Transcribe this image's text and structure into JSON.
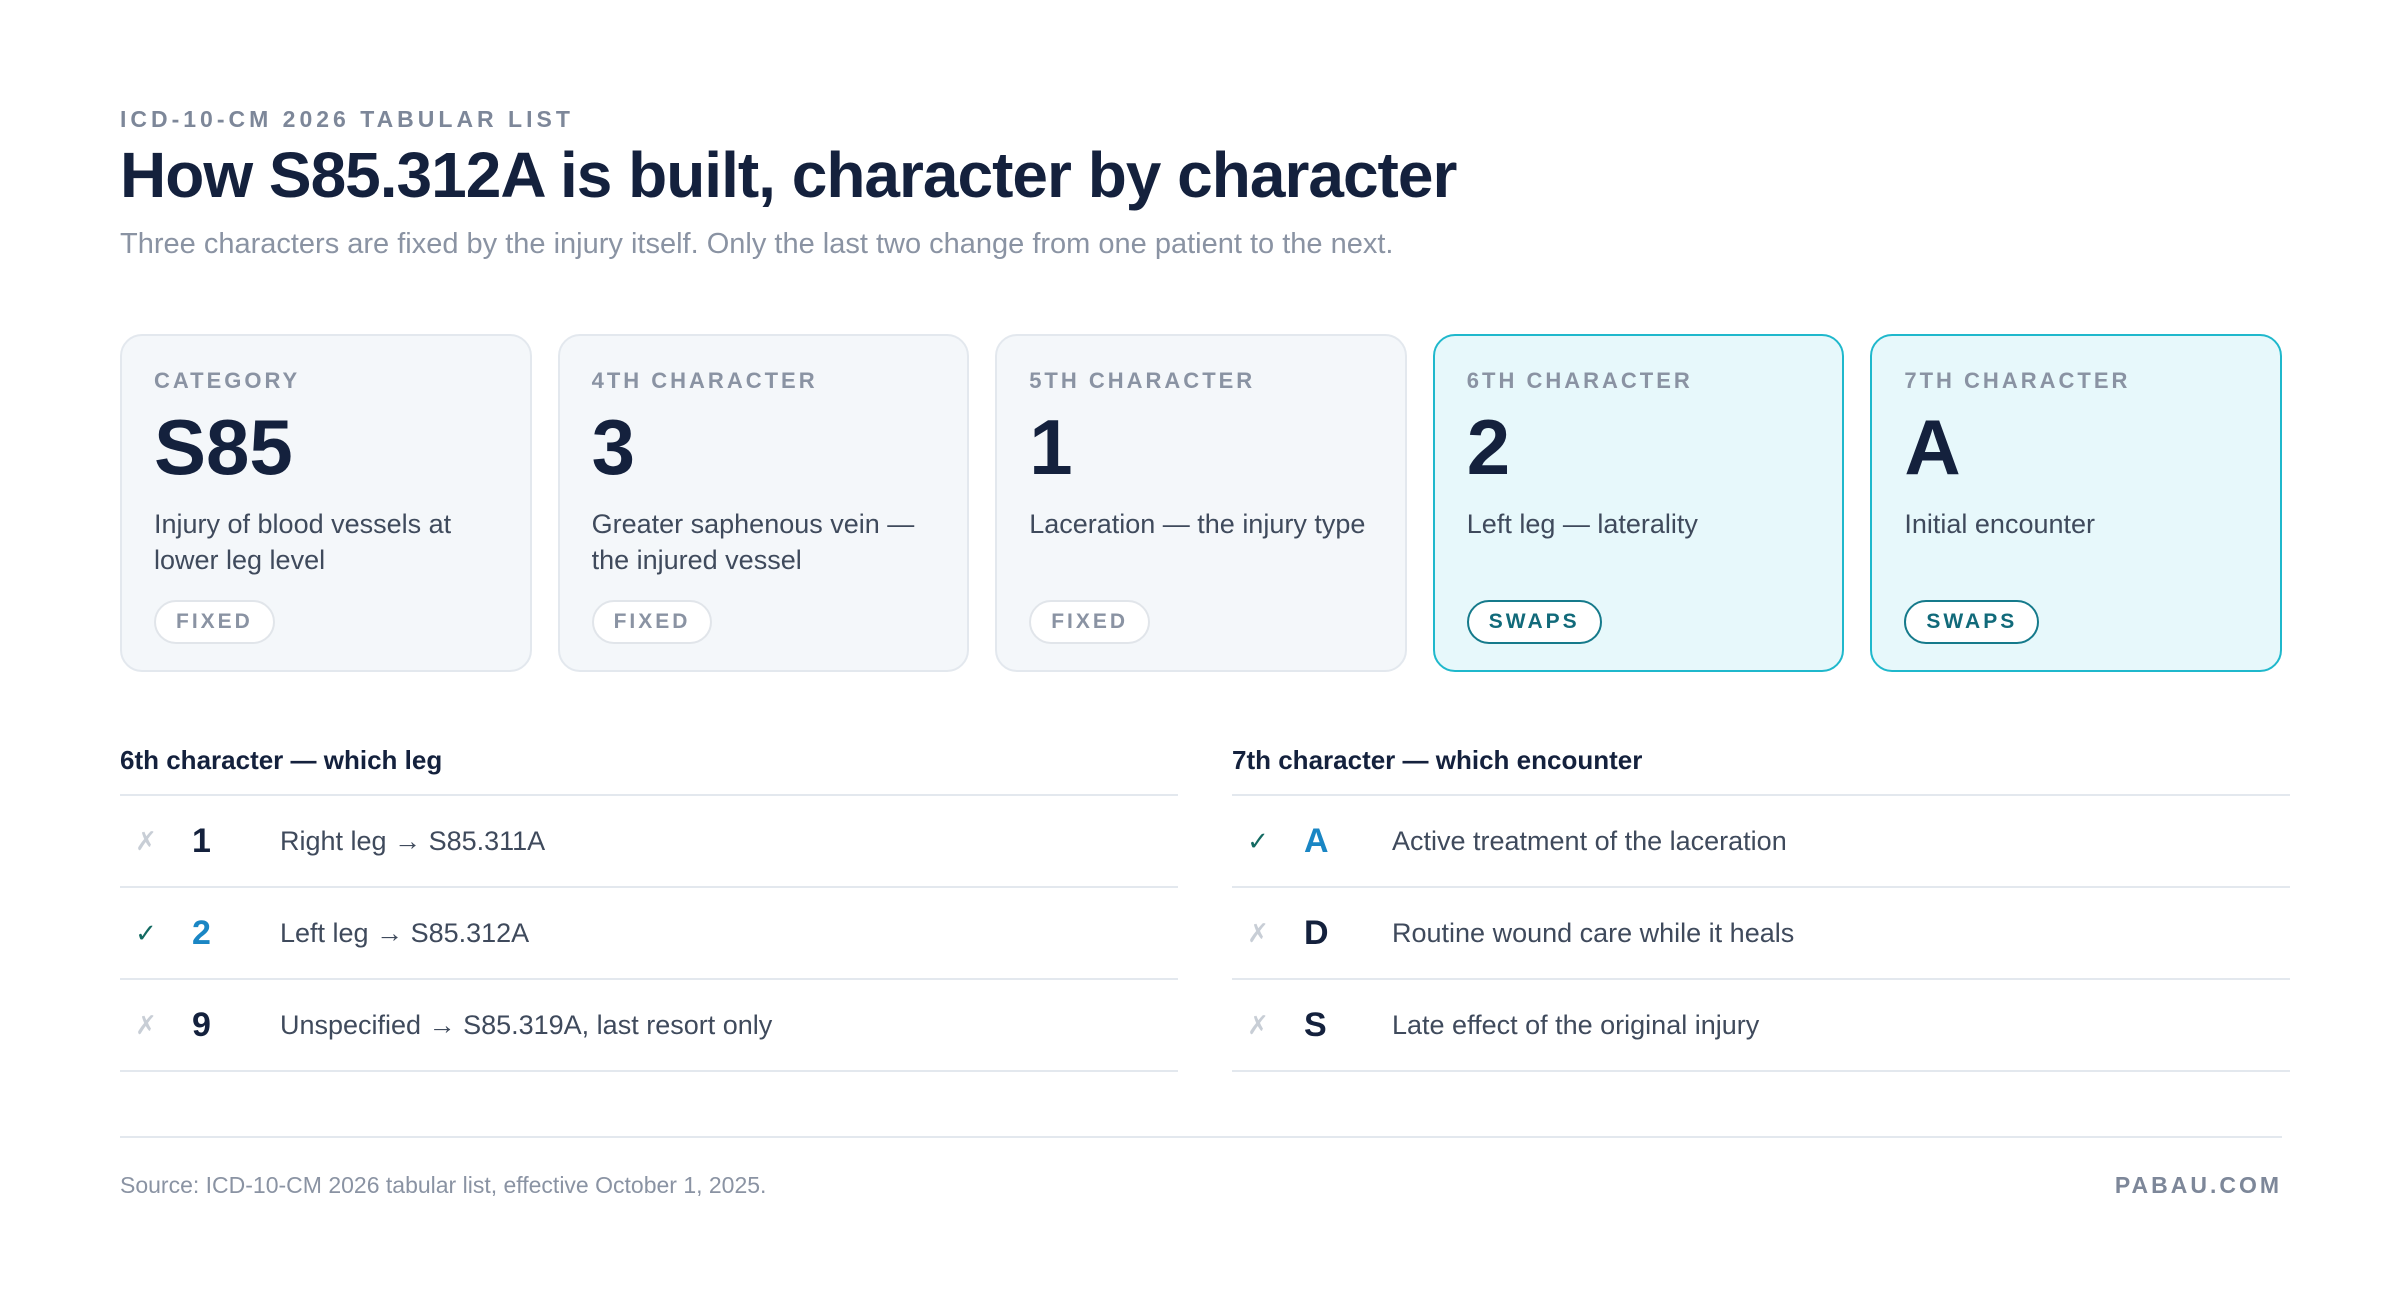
{
  "header": {
    "eyebrow": "ICD-10-CM 2026 TABULAR LIST",
    "title": "How S85.312A is built, character by character",
    "subtitle": "Three characters are fixed by the injury itself. Only the last two change from one patient to the next."
  },
  "cards": [
    {
      "label": "CATEGORY",
      "value": "S85",
      "desc": "Injury of blood vessels at lower leg level",
      "tag": "FIXED"
    },
    {
      "label": "4TH CHARACTER",
      "value": "3",
      "desc": "Greater saphenous vein — the injured vessel",
      "tag": "FIXED"
    },
    {
      "label": "5TH CHARACTER",
      "value": "1",
      "desc": "Laceration — the injury type",
      "tag": "FIXED"
    },
    {
      "label": "6TH CHARACTER",
      "value": "2",
      "desc": "Left leg — laterality",
      "tag": "SWAPS"
    },
    {
      "label": "7TH CHARACTER",
      "value": "A",
      "desc": "Initial encounter",
      "tag": "SWAPS"
    }
  ],
  "sixth": {
    "heading": "6th character — which leg",
    "rows": [
      {
        "mark": "✗",
        "code": "1",
        "text": "Right leg → S85.311A"
      },
      {
        "mark": "✓",
        "code": "2",
        "text": "Left leg → S85.312A"
      },
      {
        "mark": "✗",
        "code": "9",
        "text": "Unspecified → S85.319A, last resort only"
      }
    ]
  },
  "seventh": {
    "heading": "7th character — which encounter",
    "rows": [
      {
        "mark": "✓",
        "code": "A",
        "text": "Active treatment of the laceration"
      },
      {
        "mark": "✗",
        "code": "D",
        "text": "Routine wound care while it heals"
      },
      {
        "mark": "✗",
        "code": "S",
        "text": "Late effect of the original injury"
      }
    ]
  },
  "footer": {
    "source": "Source: ICD-10-CM 2026 tabular list, effective October 1, 2025.",
    "brand": "PABAU.COM"
  },
  "colors": {
    "accent": "#1a86c4",
    "swap_border": "#1fb8cc",
    "check": "#136a62"
  }
}
